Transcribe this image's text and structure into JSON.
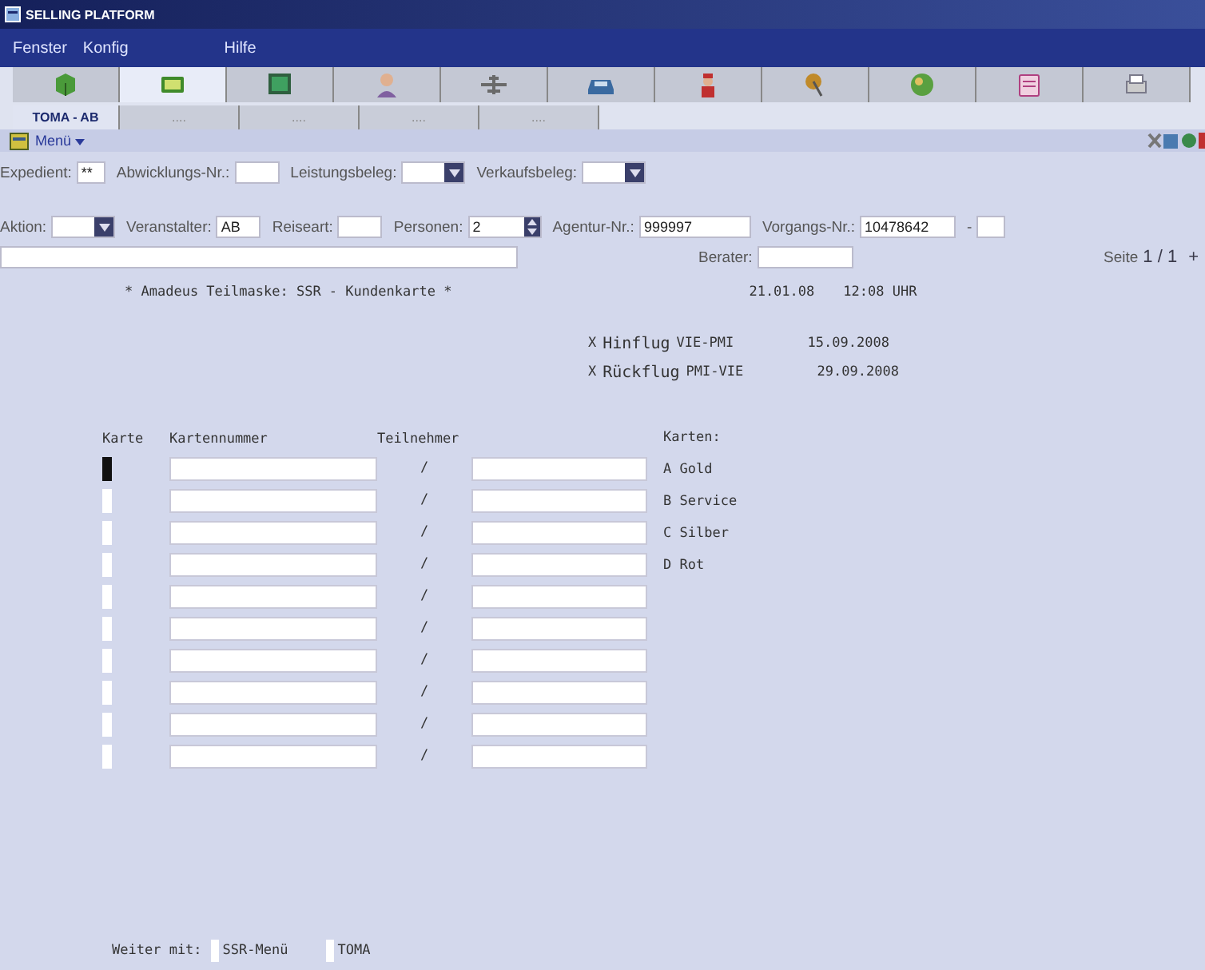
{
  "window": {
    "title": "SELLING PLATFORM"
  },
  "menu": [
    "Fenster",
    "Konfig",
    "Hilfe"
  ],
  "toolbar_tabs": [
    {
      "selected": false
    },
    {
      "selected": true
    },
    {
      "selected": false
    },
    {
      "selected": false
    },
    {
      "selected": false
    },
    {
      "selected": false
    },
    {
      "selected": false
    },
    {
      "selected": false
    },
    {
      "selected": false
    },
    {
      "selected": false
    },
    {
      "selected": false
    }
  ],
  "session_tabs": [
    {
      "label": "TOMA - AB",
      "selected": true
    },
    {
      "label": "....",
      "selected": false
    },
    {
      "label": "....",
      "selected": false
    },
    {
      "label": "....",
      "selected": false
    },
    {
      "label": "....",
      "selected": false
    }
  ],
  "menu_button": "Menü",
  "form_rows": [
    {
      "fields": [
        {
          "label": "Expedient:",
          "kind": "text",
          "value": "**"
        },
        {
          "label": "Abwicklungs-Nr.:",
          "kind": "text"
        },
        {
          "label": "Leistungsbeleg:",
          "kind": "dropdown"
        },
        {
          "label": "Verkaufsbeleg:",
          "kind": "dropdown"
        }
      ]
    },
    {
      "fields": [
        {
          "label": "Aktion:",
          "kind": "dropdown"
        },
        {
          "label": "Veranstalter:",
          "kind": "text",
          "value": "AB"
        },
        {
          "label": "Reiseart:",
          "kind": "text"
        },
        {
          "label": "Personen:",
          "kind": "spinner",
          "value": "2"
        },
        {
          "label": "Agentur-Nr.:",
          "kind": "text",
          "value": "999997"
        },
        {
          "label": "Vorgangs-Nr.:",
          "kind": "text",
          "value": "10478642"
        },
        {
          "label": "-",
          "kind": "text"
        }
      ]
    }
  ],
  "info_row": {
    "berater_label": "Berater:",
    "page_label": "Seite",
    "page": "1 / 1",
    "next": "+"
  },
  "terminal": {
    "title": "* Amadeus Teilmaske: SSR - Kundenkarte *",
    "date": "21.01.08",
    "time": "12:08 UHR",
    "flights": [
      {
        "mark": "X",
        "label": "Hinflug",
        "route": "VIE-PMI",
        "date": "15.09.2008"
      },
      {
        "mark": "X",
        "label": "Rückflug",
        "route": "PMI-VIE",
        "date": "29.09.2008"
      }
    ],
    "columns": [
      "Karte",
      "Kartennummer",
      "Teilnehmer"
    ],
    "card_types_title": "Karten:",
    "card_types": [
      "A Gold",
      "B Service",
      "C Silber",
      "D Rot"
    ],
    "rows": [
      {
        "cursor": true,
        "separator": "/"
      },
      {
        "cursor": false,
        "separator": "/"
      },
      {
        "cursor": false,
        "separator": "/"
      },
      {
        "cursor": false,
        "separator": "/"
      },
      {
        "cursor": false,
        "separator": "/"
      },
      {
        "cursor": false,
        "separator": "/"
      },
      {
        "cursor": false,
        "separator": "/"
      },
      {
        "cursor": false,
        "separator": "/"
      },
      {
        "cursor": false,
        "separator": "/"
      },
      {
        "cursor": false,
        "separator": "/"
      }
    ],
    "footer_label": "Weiter mit:",
    "footer_options": [
      "SSR-Menü",
      "TOMA"
    ]
  }
}
